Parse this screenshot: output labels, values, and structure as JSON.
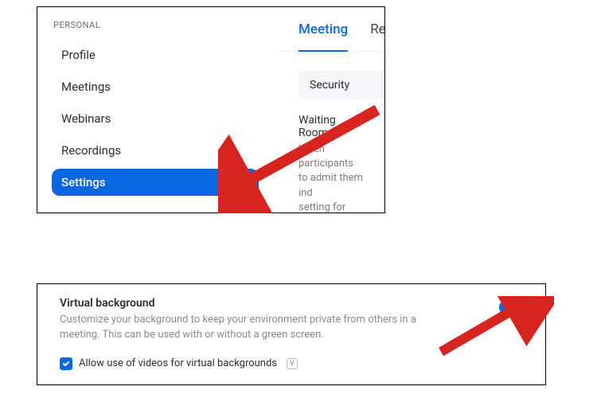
{
  "sidebar": {
    "section_label": "PERSONAL",
    "items": [
      {
        "label": "Profile"
      },
      {
        "label": "Meetings"
      },
      {
        "label": "Webinars"
      },
      {
        "label": "Recordings"
      },
      {
        "label": "Settings"
      }
    ]
  },
  "tabs": {
    "items": [
      {
        "label": "Meeting"
      },
      {
        "label": "Re"
      }
    ]
  },
  "sections": {
    "security_label": "Security",
    "waiting_room": {
      "title": "Waiting Room",
      "line1": "When participants",
      "line2": "to admit them ind",
      "line3": "setting for allowin"
    }
  },
  "virtual_bg": {
    "title": "Virtual background",
    "description": "Customize your background to keep your environment private from others in a meeting. This can be used with or without a green screen.",
    "allow_videos_label": "Allow use of videos for virtual backgrounds",
    "info_badge": "V"
  }
}
